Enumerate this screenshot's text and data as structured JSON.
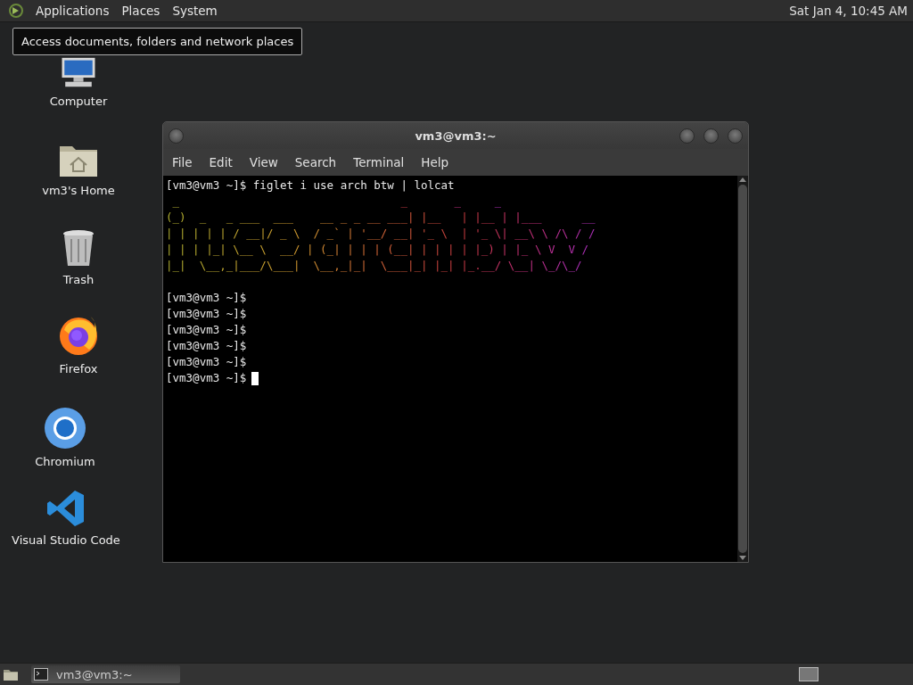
{
  "top_panel": {
    "menus": [
      {
        "label": "Applications",
        "selected": false
      },
      {
        "label": "Places",
        "selected": false
      },
      {
        "label": "System",
        "selected": false
      }
    ],
    "clock": "Sat Jan 4, 10:45 AM"
  },
  "tooltip": "Access documents, folders and network places",
  "desktop_icons": [
    {
      "kind": "computer",
      "label": "Computer"
    },
    {
      "kind": "home",
      "label": "vm3's Home"
    },
    {
      "kind": "trash",
      "label": "Trash"
    },
    {
      "kind": "firefox",
      "label": "Firefox"
    },
    {
      "kind": "chromium",
      "label": "Chromium"
    },
    {
      "kind": "vscode",
      "label": "Visual Studio Code"
    }
  ],
  "terminal": {
    "title": "vm3@vm3:~",
    "menu": [
      "File",
      "Edit",
      "View",
      "Search",
      "Terminal",
      "Help"
    ],
    "lines": [
      {
        "kind": "command",
        "text": "[vm3@vm3 ~]$ figlet i use arch btw | lolcat"
      },
      {
        "kind": "art",
        "text": " _                                 _       _     _"
      },
      {
        "kind": "art",
        "text": "(_)  _   _ ___  ___    __ _ _ __ ___| |__   | |__ | |___      __"
      },
      {
        "kind": "art",
        "text": "| | | | | / __|/ _ \\  / _` | '__/ __| '_ \\  | '_ \\| __\\ \\ /\\ / /"
      },
      {
        "kind": "art",
        "text": "| | | |_| \\__ \\  __/ | (_| | | | (__| | | | | |_) | |_ \\ V  V /"
      },
      {
        "kind": "art",
        "text": "|_|  \\__,_|___/\\___|  \\__,_|_|  \\___|_| |_| |_.__/ \\__| \\_/\\_/"
      },
      {
        "kind": "blank"
      },
      {
        "kind": "command",
        "text": "[vm3@vm3 ~]$"
      },
      {
        "kind": "command",
        "text": "[vm3@vm3 ~]$"
      },
      {
        "kind": "command",
        "text": "[vm3@vm3 ~]$"
      },
      {
        "kind": "command",
        "text": "[vm3@vm3 ~]$"
      },
      {
        "kind": "command",
        "text": "[vm3@vm3 ~]$"
      },
      {
        "kind": "prompt",
        "text": "[vm3@vm3 ~]$"
      }
    ]
  },
  "bottom_panel": {
    "tasks": [
      {
        "label": "vm3@vm3:~",
        "selected": true
      }
    ]
  }
}
